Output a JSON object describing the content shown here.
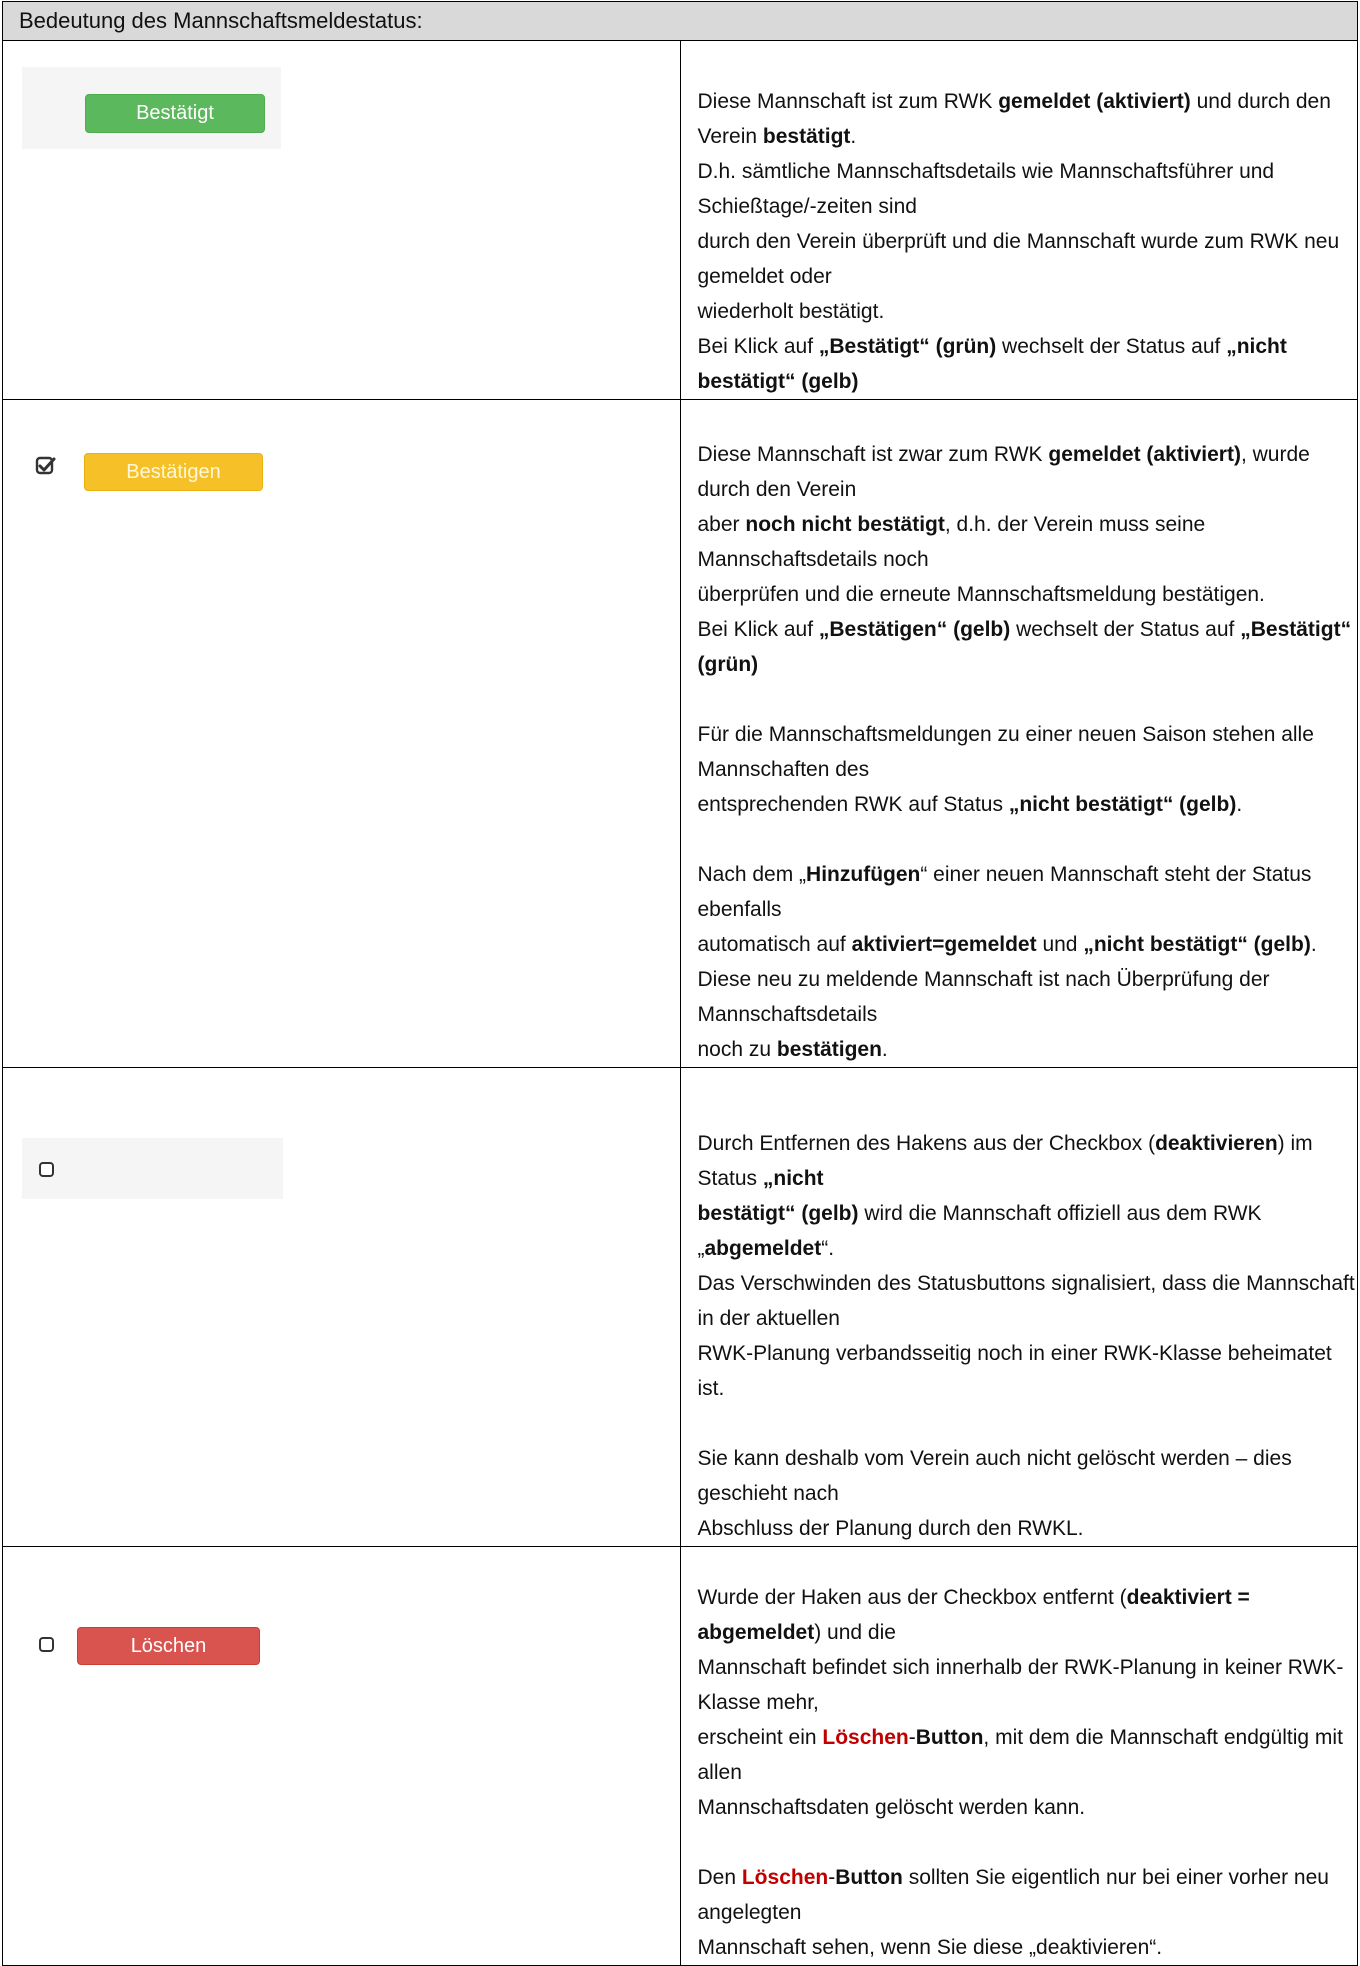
{
  "header": {
    "title": "Bedeutung des Mannschaftsmeldestatus:"
  },
  "rows": [
    {
      "button_label": "Bestätigt",
      "button_color": "#5cb85c",
      "paragraphs": [
        [
          {
            "t": "Diese Mannschaft ist zum RWK "
          },
          {
            "t": "gemeldet (aktiviert)",
            "b": true
          },
          {
            "t": " und durch den Verein "
          },
          {
            "t": "bestätigt",
            "b": true
          },
          {
            "t": "."
          }
        ],
        [
          {
            "t": "D.h. sämtliche Mannschaftsdetails wie Mannschaftsführer und Schießtage/-zeiten sind"
          }
        ],
        [
          {
            "t": "durch den Verein überprüft und die Mannschaft wurde zum RWK neu gemeldet oder"
          }
        ],
        [
          {
            "t": "wiederholt bestätigt."
          }
        ],
        [
          {
            "t": "Bei Klick auf "
          },
          {
            "t": "„Bestätigt“ (grün)",
            "b": true
          },
          {
            "t": " wechselt der Status auf "
          },
          {
            "t": "„nicht bestätigt“ (gelb)",
            "b": true
          }
        ]
      ]
    },
    {
      "button_label": "Bestätigen",
      "button_color": "#f6c128",
      "paragraphs": [
        [
          {
            "t": "Diese Mannschaft ist zwar zum RWK "
          },
          {
            "t": "gemeldet (aktiviert)",
            "b": true
          },
          {
            "t": ", wurde durch den Verein"
          }
        ],
        [
          {
            "t": "aber "
          },
          {
            "t": "noch nicht bestätigt",
            "b": true
          },
          {
            "t": ", d.h. der Verein muss seine Mannschaftsdetails noch"
          }
        ],
        [
          {
            "t": "überprüfen und die erneute Mannschaftsmeldung bestätigen."
          }
        ],
        [
          {
            "t": "Bei Klick auf "
          },
          {
            "t": "„Bestätigen“ (gelb)",
            "b": true
          },
          {
            "t": " wechselt der Status auf "
          },
          {
            "t": "„Bestätigt“ (grün)",
            "b": true
          }
        ],
        [],
        [
          {
            "t": "Für die Mannschaftsmeldungen zu einer neuen Saison stehen alle Mannschaften des"
          }
        ],
        [
          {
            "t": "entsprechenden RWK auf Status "
          },
          {
            "t": "„nicht bestätigt“ (gelb)",
            "b": true
          },
          {
            "t": "."
          }
        ],
        [],
        [
          {
            "t": "Nach dem „"
          },
          {
            "t": "Hinzufügen",
            "b": true
          },
          {
            "t": "“ einer neuen Mannschaft steht der Status ebenfalls"
          }
        ],
        [
          {
            "t": "automatisch auf "
          },
          {
            "t": "aktiviert=gemeldet",
            "b": true
          },
          {
            "t": " und "
          },
          {
            "t": "„nicht bestätigt“ (gelb)",
            "b": true
          },
          {
            "t": "."
          }
        ],
        [
          {
            "t": "Diese neu zu meldende Mannschaft ist nach Überprüfung der Mannschaftsdetails"
          }
        ],
        [
          {
            "t": "noch zu "
          },
          {
            "t": "bestätigen",
            "b": true
          },
          {
            "t": "."
          }
        ]
      ]
    },
    {
      "paragraphs": [
        [
          {
            "t": "Durch Entfernen des Hakens aus der Checkbox ("
          },
          {
            "t": "deaktivieren",
            "b": true
          },
          {
            "t": ") im Status "
          },
          {
            "t": "„nicht",
            "b": true
          }
        ],
        [
          {
            "t": "bestätigt“ (gelb)",
            "b": true
          },
          {
            "t": " wird die Mannschaft offiziell aus dem RWK „"
          },
          {
            "t": "abgemeldet",
            "b": true
          },
          {
            "t": "“."
          }
        ],
        [
          {
            "t": "Das Verschwinden des Statusbuttons signalisiert, dass die Mannschaft in der aktuellen"
          }
        ],
        [
          {
            "t": "RWK-Planung verbandsseitig noch in einer RWK-Klasse beheimatet ist."
          }
        ],
        [],
        [
          {
            "t": "Sie kann deshalb vom Verein auch nicht gelöscht werden – dies geschieht nach"
          }
        ],
        [
          {
            "t": "Abschluss der Planung durch den RWKL."
          }
        ]
      ]
    },
    {
      "button_label": "Löschen",
      "button_color": "#d9534f",
      "paragraphs": [
        [
          {
            "t": "Wurde der Haken aus der Checkbox entfernt ("
          },
          {
            "t": "deaktiviert = abgemeldet",
            "b": true
          },
          {
            "t": ") und die"
          }
        ],
        [
          {
            "t": "Mannschaft befindet sich innerhalb der RWK-Planung in keiner RWK-Klasse mehr,"
          }
        ],
        [
          {
            "t": "erscheint ein "
          },
          {
            "t": "Löschen",
            "r": true
          },
          {
            "t": "-"
          },
          {
            "t": "Button",
            "b": true
          },
          {
            "t": ", mit dem die Mannschaft endgültig mit allen"
          }
        ],
        [
          {
            "t": "Mannschaftsdaten gelöscht werden kann."
          }
        ],
        [],
        [
          {
            "t": "Den "
          },
          {
            "t": "Löschen",
            "r": true
          },
          {
            "t": "-"
          },
          {
            "t": "Button",
            "b": true
          },
          {
            "t": " sollten Sie eigentlich nur bei einer vorher neu angelegten"
          }
        ],
        [
          {
            "t": "Mannschaft sehen, wenn Sie diese „deaktivieren“."
          }
        ]
      ]
    }
  ]
}
